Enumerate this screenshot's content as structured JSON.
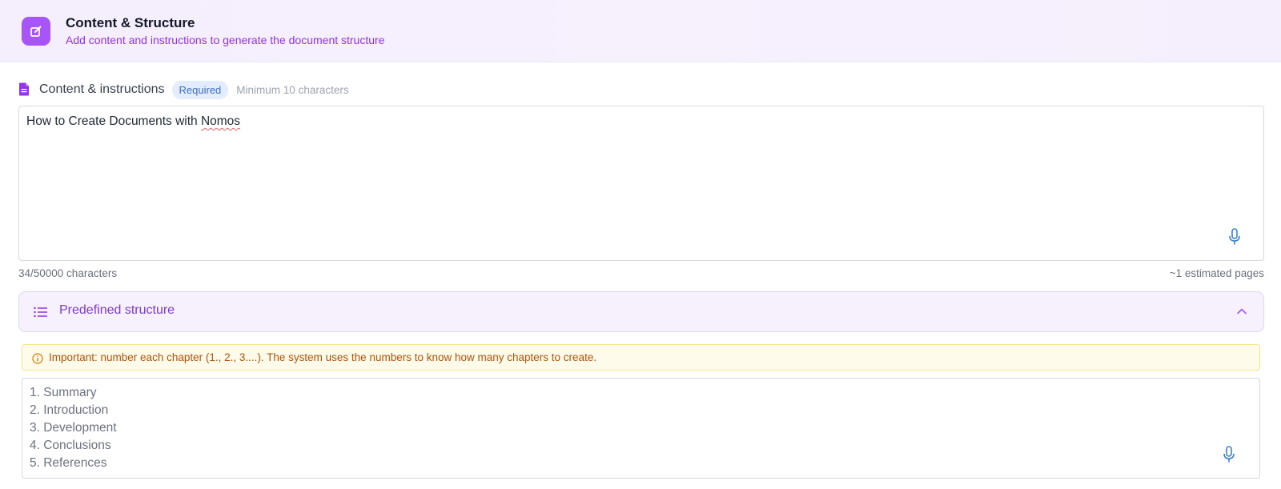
{
  "header": {
    "icon": "edit-square-icon",
    "title": "Content & Structure",
    "subtitle": "Add content and instructions to generate the document structure"
  },
  "content_section": {
    "icon": "document-icon",
    "label": "Content & instructions",
    "badge": "Required",
    "hint": "Minimum 10 characters",
    "textarea_value_prefix": "How to Create Documents with ",
    "textarea_value_misspelled": "Nomos",
    "mic_icon": "microphone-icon",
    "char_count": "34/50000 characters",
    "estimated_pages": "~1 estimated pages"
  },
  "predefined_structure": {
    "icon": "list-icon",
    "title": "Predefined structure",
    "toggle_icon": "chevron-up-icon",
    "expanded": true,
    "warning_icon": "info-circle-icon",
    "warning": "Important: number each chapter (1., 2., 3....). The system uses the numbers to know how many chapters to create.",
    "lines": [
      "1. Summary",
      "2. Introduction",
      "3. Development",
      "4. Conclusions",
      "5. References"
    ],
    "mic_icon": "microphone-icon"
  },
  "colors": {
    "accent_purple": "#a855f7",
    "subtitle_purple": "#9333ea",
    "badge_blue": "#3b6fc8",
    "warning_text": "#b45309",
    "warning_bg": "#fefbea"
  }
}
